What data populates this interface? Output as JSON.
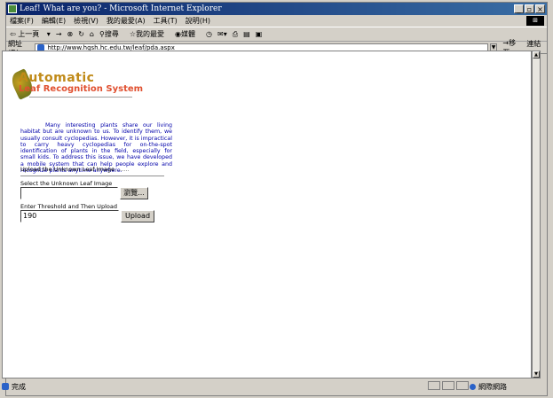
{
  "window": {
    "title": "Leaf! What are you? - Microsoft Internet Explorer"
  },
  "menu": [
    "檔案(F)",
    "編輯(E)",
    "檢視(V)",
    "我的最愛(A)",
    "工具(T)",
    "說明(H)"
  ],
  "toolbar": {
    "back": "上一頁",
    "forward": "→",
    "search": "搜尋",
    "favorites": "我的最愛",
    "media": "媒體"
  },
  "address": {
    "label": "網址(D)",
    "url": "http://www.hgsh.hc.edu.tw/leaf/pda.aspx",
    "go": "移至",
    "links": "連結"
  },
  "page": {
    "logo_line1": "Automatic",
    "logo_line2": "Leaf Recognition System",
    "intro": "Many interesting plants share our living habitat but are unknown to us. To identify them, we usually consult cyclopedias. However, it is impractical to carry heavy cyclopedias for on-the-spot identification of plants in the field, especially for small kids. To address this issue, we have developed a mobile system that can help people explore and recognize plants anytime anywhere.",
    "upload_heading": "Upload the Unknown Leaf Image",
    "upload_dots": ".......",
    "select_label": "Select the Unknown Leaf Image",
    "file_value": "",
    "browse_label": "瀏覽...",
    "threshold_label": "Enter Threshold and Then Upload",
    "threshold_value": "190",
    "upload_button": "Upload"
  },
  "status": {
    "text": "完成",
    "zone": "網際網路"
  }
}
